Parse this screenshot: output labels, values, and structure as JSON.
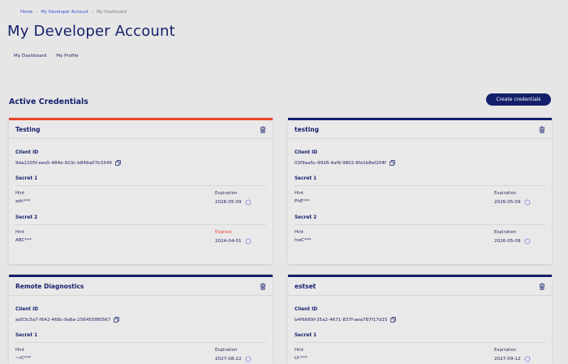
{
  "breadcrumb": [
    "Home",
    "My Developer Account",
    "My Dashboard"
  ],
  "page_title": "My Developer Account",
  "subnav": [
    "My Dashboard",
    "My Profile"
  ],
  "section_title": "Active Credentials",
  "create_button": "Create credentials",
  "labels": {
    "client_id": "Client ID",
    "secret1": "Secret 1",
    "secret2": "Secret 2",
    "hint": "Hint",
    "expiration": "Expiration"
  },
  "colors": {
    "primary": "#141f6b",
    "accent": "#e8442c",
    "background": "#e6e6e6"
  },
  "cards": [
    {
      "title": "Testing",
      "client_id": "9da2205f-eee5-484e-923c-b849a07b3349",
      "secret1": {
        "hint": "adc***",
        "expiration_label": "Expiration",
        "expiration": "2026-05-09"
      },
      "secret2": {
        "hint": "ABC***",
        "expiration_label": "Expired",
        "expiration": "2024-04-01"
      }
    },
    {
      "title": "testing",
      "client_id": "03f9aa5c-9926-4af9-9802-6fe1b8ef204f",
      "secret1": {
        "hint": "PhE***",
        "expiration_label": "Expiration",
        "expiration": "2026-05-09"
      },
      "secret2": {
        "hint": "hwC***",
        "expiration_label": "Expiration",
        "expiration": "2026-05-09"
      }
    },
    {
      "title": "Remote Diagnostics",
      "client_id": "ad53c3a7-f642-468c-9a6e-256455f80567",
      "secret1": {
        "hint": "~rC***",
        "expiration_label": "Expiration",
        "expiration": "2027-08-22"
      }
    },
    {
      "title": "estset",
      "client_id": "b4f6669f-35a2-4671-837f-aea787f17d15",
      "secret1": {
        "hint": "LY-***",
        "expiration_label": "Expiration",
        "expiration": "2027-09-12"
      }
    }
  ]
}
